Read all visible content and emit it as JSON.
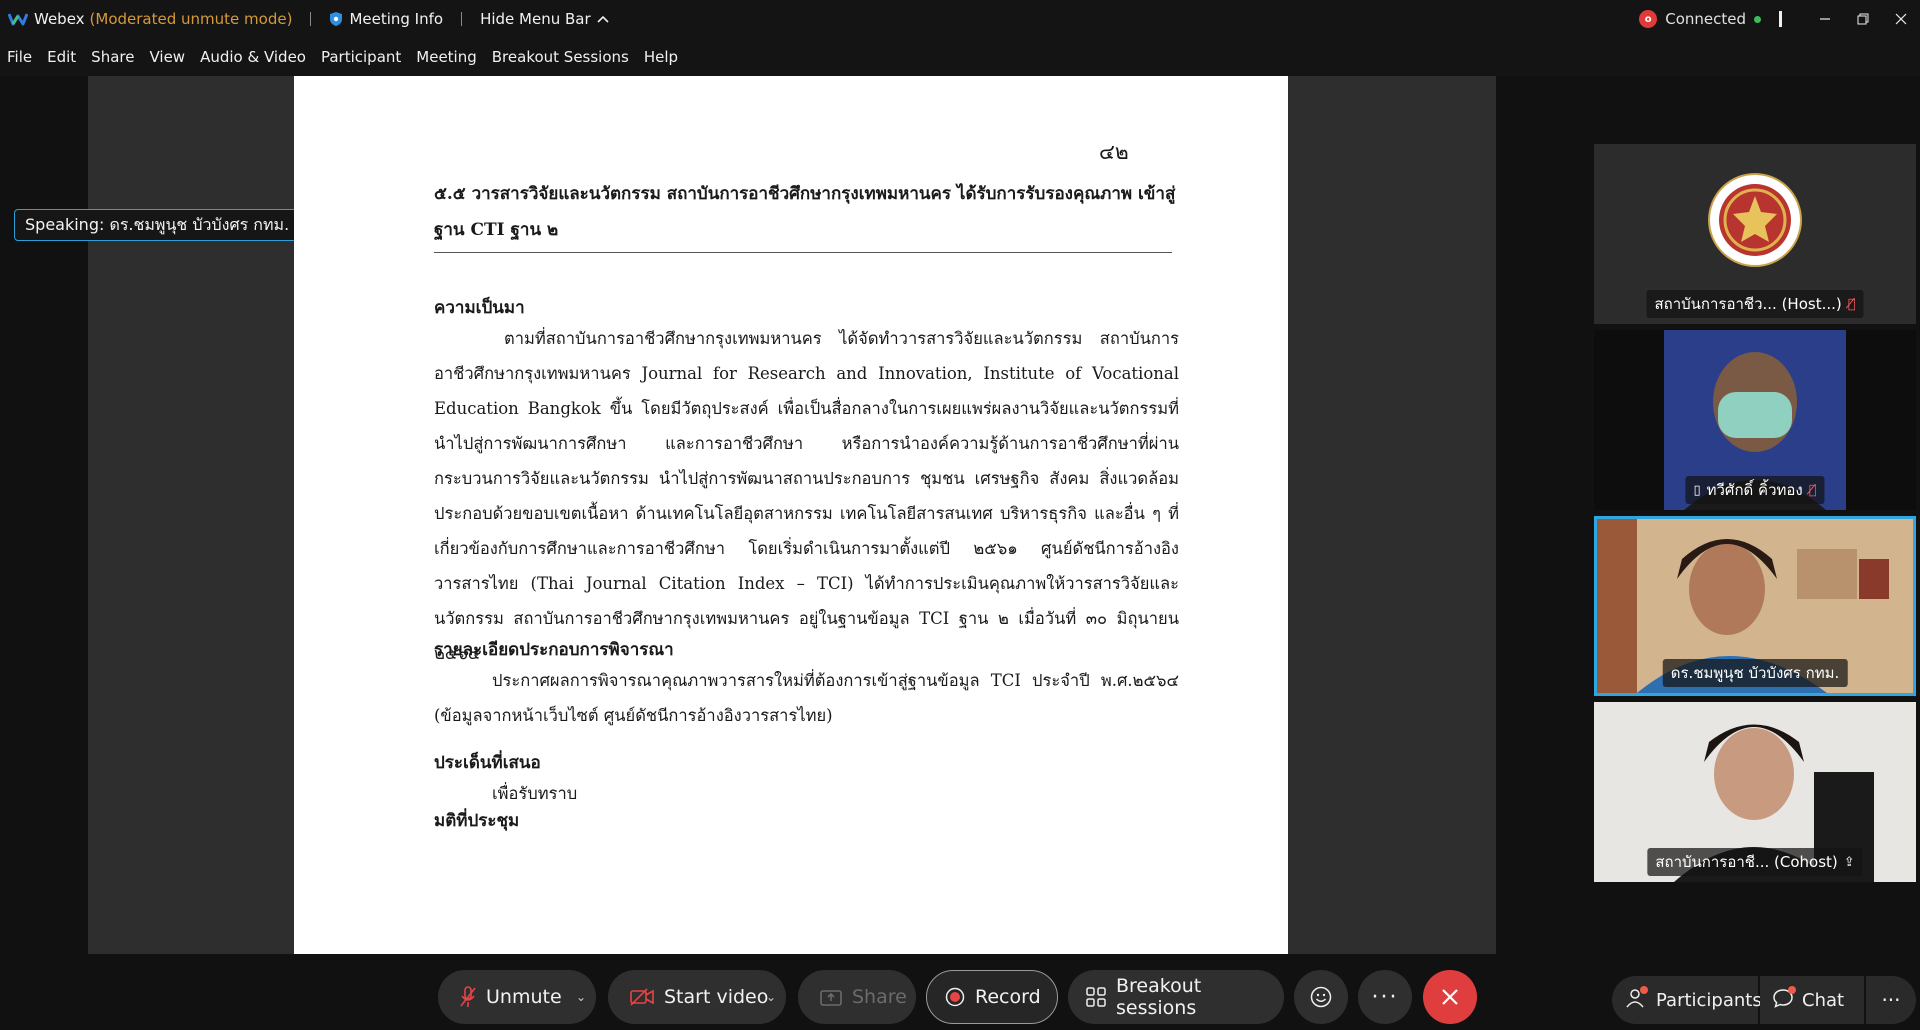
{
  "titlebar": {
    "app_name": "Webex",
    "mode": "(Moderated unmute mode)",
    "meeting_info": "Meeting Info",
    "hide_menu": "Hide Menu Bar",
    "connection_status": "Connected"
  },
  "menu": [
    "File",
    "Edit",
    "Share",
    "View",
    "Audio & Video",
    "Participant",
    "Meeting",
    "Breakout Sessions",
    "Help"
  ],
  "speaking_label": "Speaking: ดร.ชมพูนุช บัวบังศร กทม.",
  "document": {
    "page_number": "๔๒",
    "heading": "๕.๕  วารสารวิจัยและนวัตกรรม สถาบันการอาชีวศึกษากรุงเทพมหานคร ได้รับการรับรองคุณภาพ เข้าสู่ฐาน CTI ฐาน ๒",
    "section1_title": "ความเป็นมา",
    "section1_body": "ตามที่สถาบันการอาชีวศึกษากรุงเทพมหานคร ได้จัดทำวารสารวิจัยและนวัตกรรม สถาบันการอาชีวศึกษากรุงเทพมหานคร Journal for Research and Innovation, Institute of Vocational Education Bangkok ขึ้น โดยมีวัตถุประสงค์ เพื่อเป็นสื่อกลางในการเผยแพร่ผลงานวิจัยและนวัตกรรมที่นำไปสู่การพัฒนาการศึกษา และการอาชีวศึกษา หรือการนำองค์ความรู้ด้านการอาชีวศึกษาที่ผ่านกระบวนการวิจัยและนวัตกรรม นำไปสู่การพัฒนาสถานประกอบการ ชุมชน เศรษฐกิจ สังคม สิ่งแวดล้อม ประกอบด้วยขอบเขตเนื้อหา ด้านเทคโนโลยีอุตสาหกรรม เทคโนโลยีสารสนเทศ บริหารธุรกิจ และอื่น ๆ ที่เกี่ยวข้องกับการศึกษาและการอาชีวศึกษา โดยเริ่มดำเนินการมาตั้งแต่ปี ๒๕๖๑ ศูนย์ดัชนีการอ้างอิงวารสารไทย (Thai Journal Citation Index – TCI) ได้ทำการประเมินคุณภาพให้วารสารวิจัยและนวัตกรรม สถาบันการอาชีวศึกษากรุงเทพมหานคร อยู่ในฐานข้อมูล TCI  ฐาน ๒ เมื่อวันที่ ๓๐ มิถุนายน ๒๕๖๔",
    "section2_title": "รายละเอียดประกอบการพิจารณา",
    "section2_body": "ประกาศผลการพิจารณาคุณภาพวารสารใหม่ที่ต้องการเข้าสู่ฐานข้อมูล TCI ประจำปี พ.ศ.๒๕๖๔ (ข้อมูลจากหน้าเว็บไซต์ ศูนย์ดัชนีการอ้างอิงวารสารไทย)",
    "section3_title": "ประเด็นที่เสนอ",
    "section3_body": "เพื่อรับทราบ",
    "section4_title": "มติที่ประชุม"
  },
  "participants_video": [
    {
      "name": "สถาบันการอาชีว... (Host...)",
      "muted": true
    },
    {
      "name": "ทวีศักดิ์ คิ้วทอง",
      "muted": true
    },
    {
      "name": "ดร.ชมพูนุช บัวบังศร กทม.",
      "muted": false,
      "active": true
    },
    {
      "name": "สถาบันการอาชี... (Cohost)",
      "muted": false
    }
  ],
  "controls": {
    "unmute": "Unmute",
    "start_video": "Start video",
    "share": "Share",
    "record": "Record",
    "breakout": "Breakout sessions"
  },
  "right_panel": {
    "participants": "Participants",
    "chat": "Chat"
  },
  "colors": {
    "accent_blue": "#2fa6e0",
    "leave_red": "#e03e3e",
    "mode_orange": "#d49a3a"
  }
}
